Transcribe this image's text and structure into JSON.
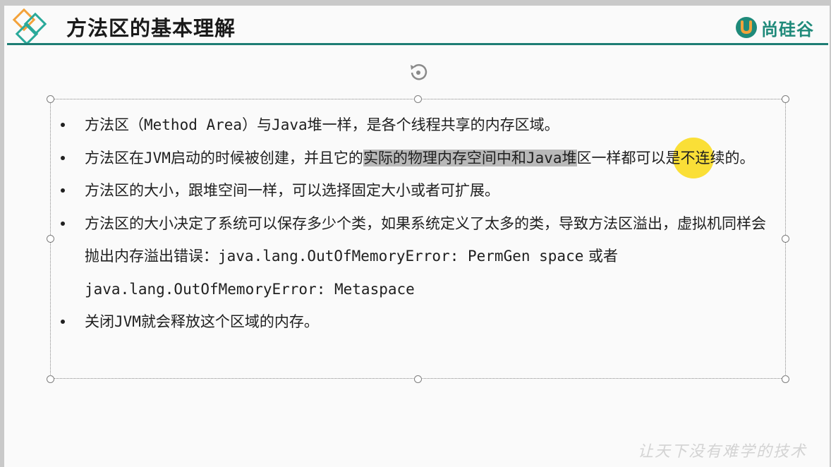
{
  "header": {
    "title": "方法区的基本理解",
    "brand_text": "尚硅谷"
  },
  "colors": {
    "accent": "#1e7d74",
    "logo_orange": "#f3a23a",
    "logo_teal": "#2aa99a",
    "cursor_highlight": "#fad700"
  },
  "bullets": [
    {
      "parts": [
        {
          "text": "方法区（"
        },
        {
          "text": "Method Area",
          "style": "mono"
        },
        {
          "text": "）与"
        },
        {
          "text": "Java",
          "style": "mono"
        },
        {
          "text": "堆一样，是各个线程共享的内存区域。"
        }
      ]
    },
    {
      "parts": [
        {
          "text": "方法区在"
        },
        {
          "text": "JVM",
          "style": "mono"
        },
        {
          "text": "启动的时候被创建，并且它的"
        },
        {
          "text": "实际的物理内存空间中和",
          "style": "hl"
        },
        {
          "text": "Java",
          "style": "mono hl"
        },
        {
          "text": "堆",
          "style": "hl"
        },
        {
          "text": "区一样都可以是不连续的。"
        }
      ]
    },
    {
      "parts": [
        {
          "text": "方法区的大小，跟堆空间一样，可以选择固定大小或者可扩展。"
        }
      ]
    },
    {
      "parts": [
        {
          "text": "方法区的大小决定了系统可以保存多少个类，如果系统定义了太多的类，导致方法区溢出，虚拟机同样会抛出内存溢出错误："
        },
        {
          "text": "java.lang.OutOfMemoryError: PermGen space",
          "style": "mono"
        },
        {
          "text": " 或者 "
        },
        {
          "text": "java.lang.OutOfMemoryError: Metaspace",
          "style": "mono"
        }
      ]
    },
    {
      "parts": [
        {
          "text": "关闭"
        },
        {
          "text": "JVM",
          "style": "mono"
        },
        {
          "text": "就会释放这个区域的内存。"
        }
      ]
    }
  ],
  "watermark": "让天下没有难学的技术"
}
